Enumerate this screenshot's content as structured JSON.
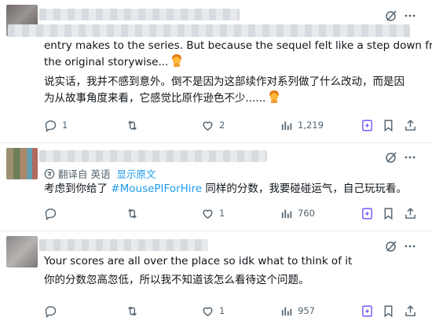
{
  "posts": [
    {
      "text_lines": [
        "entry makes to the series. But because the sequel felt like a step down from",
        "the original storywise...",
        "说实话，我并不感到意外。倒不是因为这部续作对系列做了什么改动，而是因",
        "为从故事角度来看，它感觉比原作逊色不少......"
      ],
      "stats": {
        "replies": "1",
        "reposts": "",
        "likes": "2",
        "views": "1,219"
      }
    },
    {
      "translated": {
        "label": "翻译自 英语",
        "show_original": "显示原文"
      },
      "text_before": "考虑到你给了 ",
      "hashtag": "#MousePIForHire",
      "text_after": " 同样的分数，我要碰碰运气，自己玩玩看。",
      "stats": {
        "replies": "",
        "reposts": "",
        "likes": "1",
        "views": "760"
      }
    },
    {
      "text_lines": [
        "Your scores are all over the place so idk what to think of it",
        "你的分数忽高忽低，所以我不知道该怎么看待这个问题。"
      ],
      "stats": {
        "replies": "",
        "reposts": "",
        "likes": "1",
        "views": "957"
      }
    }
  ],
  "icons": {
    "reply": "reply-icon",
    "repost": "repost-icon",
    "like": "heart-icon",
    "views": "views-chart-icon",
    "grok_image": "grok-image-icon",
    "bookmark": "bookmark-icon",
    "share": "share-icon",
    "grok": "grok-icon",
    "more": "more-icon",
    "translate": "translate-icon"
  },
  "colors": {
    "text": "#0f1419",
    "muted": "#536471",
    "link": "#1d9bf0",
    "grok_purple": "#7856ff",
    "divider": "#e6ecf0"
  }
}
